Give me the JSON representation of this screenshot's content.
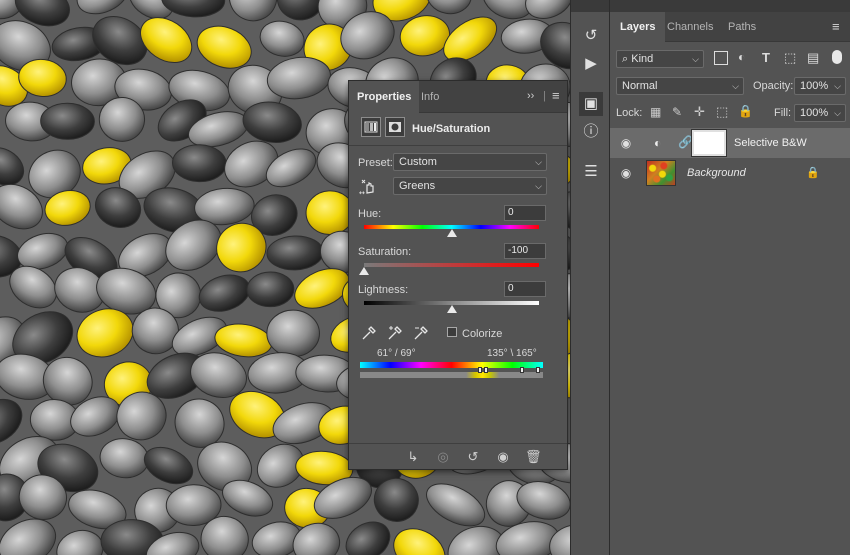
{
  "properties_panel": {
    "tabs": [
      "Properties",
      "Info"
    ],
    "collapse_glyph": "››",
    "menu_glyph": "≡",
    "title": "Hue/Saturation",
    "preset_label": "Preset:",
    "preset_value": "Custom",
    "channel_value": "Greens",
    "hue_label": "Hue:",
    "hue_value": "0",
    "saturation_label": "Saturation:",
    "saturation_value": "-100",
    "lightness_label": "Lightness:",
    "lightness_value": "0",
    "colorize_label": "Colorize",
    "colorize_checked": false,
    "range_left": "61° / 69°",
    "range_right": "135° \\ 165°",
    "slider_levels": {
      "hue": 0.5,
      "saturation": 0.0,
      "lightness": 0.5
    },
    "bottom_icons": [
      "clip-to-layer-icon",
      "view-previous-icon",
      "reset-icon",
      "visibility-icon",
      "delete-icon"
    ]
  },
  "tools_strip": {
    "icons": [
      "history-icon",
      "play-actions-icon",
      "cube-3d-icon",
      "info-icon",
      "clone-source-icon"
    ]
  },
  "layers_panel": {
    "tabs": [
      "Layers",
      "Channels",
      "Paths"
    ],
    "filter_kind": "Kind",
    "blend_mode": "Normal",
    "opacity_label": "Opacity:",
    "opacity_value": "100%",
    "lock_label": "Lock:",
    "fill_label": "Fill:",
    "fill_value": "100%",
    "layers": [
      {
        "name": "Selective B&W",
        "type": "adjustment",
        "selected": true,
        "visible": true
      },
      {
        "name": "Background",
        "type": "pixel",
        "selected": false,
        "visible": true,
        "locked": true
      }
    ]
  },
  "colors": {
    "panel_bg": "#535353",
    "tab_bar_bg": "#424242",
    "selected_layer_bg": "#6b6b6b",
    "candy_yellow": "#f2d80a",
    "candy_gray": "#8a8a8a"
  }
}
